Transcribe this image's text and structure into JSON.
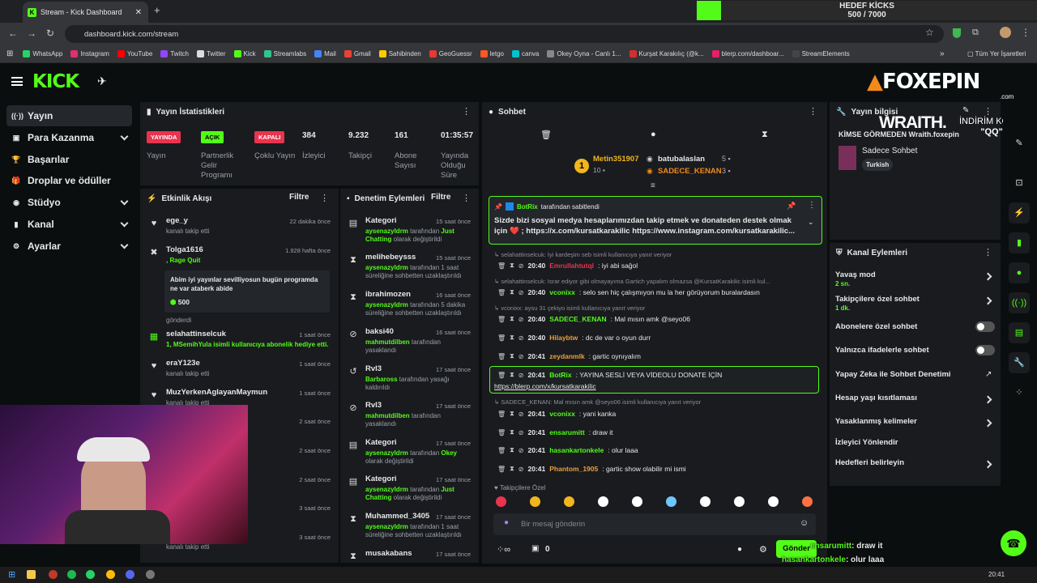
{
  "browser": {
    "tab_title": "Stream - Kick Dashboard",
    "url": "dashboard.kick.com/stream",
    "bookmarks": [
      "WhatsApp",
      "Instagram",
      "YouTube",
      "Twitch",
      "Twitter",
      "Kick",
      "Streamlabs",
      "Mail",
      "Gmail",
      "Sahibinden",
      "GeoGuessr",
      "letgo",
      "canva",
      "Okey Oyna - Canlı 1...",
      "Kurşat Karakılıç (@k...",
      "blerp.com/dashboar...",
      "StreamElements"
    ],
    "other_bookmarks": "Tüm Yer İşaretleri"
  },
  "goal": {
    "title": "HEDEF KİCKS",
    "progress_text": "500 / 7000",
    "progress": 0.0714
  },
  "sidebar": {
    "items": [
      {
        "label": "Yayın",
        "icon": "((·))"
      },
      {
        "label": "Para Kazanma",
        "icon": "▣"
      },
      {
        "label": "Başarılar",
        "icon": "🏆"
      },
      {
        "label": "Droplar ve ödüller",
        "icon": "🎁"
      },
      {
        "label": "Stüdyo",
        "icon": "◉"
      },
      {
        "label": "Kanal",
        "icon": "▮"
      },
      {
        "label": "Ayarlar",
        "icon": "⚙"
      }
    ]
  },
  "stats": {
    "title": "Yayın İstatistikleri",
    "items": [
      {
        "value": "YAYINDA",
        "label": "Yayın"
      },
      {
        "value": "AÇIK",
        "label": "Partnerlik Gelir Programı"
      },
      {
        "value": "KAPALI",
        "label": "Çoklu Yayın"
      },
      {
        "value": "384",
        "label": "İzleyici"
      },
      {
        "value": "9.232",
        "label": "Takipçi"
      },
      {
        "value": "161",
        "label": "Abone Sayısı"
      },
      {
        "value": "01:35:57",
        "label": "Yayında Olduğu Süre"
      }
    ]
  },
  "activity": {
    "title": "Etkinlik Akışı",
    "filter": "Filtre",
    "items": [
      {
        "name": "ege_y",
        "sub": "kanalı takip etti",
        "time": "22 dakika önce"
      },
      {
        "name": "Tolga1616",
        "sub": ", Rage Quit",
        "time": "1.928 hafta önce",
        "msg": "Abim iyi yayınlar sevilliyosun bugün programda ne var ataberk abide",
        "amount": "500",
        "sent": "gönderdi"
      },
      {
        "name": "selahattinselcuk",
        "sub": "1, MSemihYula isimli kullanıcıya abonelik hediye etti.",
        "time": "1 saat önce"
      },
      {
        "name": "eraY123e",
        "sub": "kanalı takip etti",
        "time": "1 saat önce"
      },
      {
        "name": "MuzYerkenAglayanMaymun",
        "sub": "kanalı takip etti",
        "time": "1 saat önce"
      },
      {
        "name": "",
        "sub": "",
        "time": "2 saat önce"
      },
      {
        "name": "",
        "sub": "",
        "time": "2 saat önce"
      },
      {
        "name": "",
        "sub": "",
        "time": "2 saat önce"
      },
      {
        "name": "",
        "sub": "",
        "time": "3 saat önce"
      },
      {
        "name": "",
        "sub": "kanalı takip etti",
        "time": "3 saat önce"
      }
    ]
  },
  "moderation": {
    "title": "Denetim Eylemleri",
    "filter": "Filtre",
    "items": [
      {
        "name": "Kategori",
        "actor": "aysenazyldrm",
        "action": "tarafından",
        "target": "Just Chatting",
        "suffix": "olarak değiştirildi",
        "time": "15 saat önce"
      },
      {
        "name": "melihebeysss",
        "actor": "aysenazyldrm",
        "action": "tarafından 1 saat süreliğine sohbetten uzaklaştırıldı",
        "time": "15 saat önce"
      },
      {
        "name": "ibrahimozen",
        "actor": "aysenazyldrm",
        "action": "tarafından 5 dakika süreliğine sohbetten uzaklaştırıldı",
        "time": "16 saat önce"
      },
      {
        "name": "baksi40",
        "actor": "mahmutdilben",
        "action": "tarafından yasaklandı",
        "time": "16 saat önce"
      },
      {
        "name": "Rvl3",
        "actor": "Barbaross",
        "action": "tarafından yasağı kaldırıldı",
        "time": "17 saat önce"
      },
      {
        "name": "Rvl3",
        "actor": "mahmutdilben",
        "action": "tarafından yasaklandı",
        "time": "17 saat önce"
      },
      {
        "name": "Kategori",
        "actor": "aysenazyldrm",
        "action": "tarafından",
        "target": "Okey",
        "suffix": "olarak değiştirildi",
        "time": "17 saat önce"
      },
      {
        "name": "Kategori",
        "actor": "aysenazyldrm",
        "action": "tarafından",
        "target": "Just Chatting",
        "suffix": "olarak değiştirildi",
        "time": "17 saat önce"
      },
      {
        "name": "Muhammed_3405",
        "actor": "aysenazyldrm",
        "action": "tarafından 1 saat süreliğine sohbetten uzaklaştırıldı",
        "time": "17 saat önce"
      },
      {
        "name": "musakabans",
        "actor": "",
        "action": "",
        "time": "17 saat önce"
      }
    ]
  },
  "chat": {
    "title": "Sohbet",
    "leaders": [
      {
        "name": "Metin351907",
        "count": "10"
      },
      {
        "name": "batubalaslan",
        "count": "5"
      },
      {
        "name": "SADECE_KENAN",
        "count": "3"
      }
    ],
    "pinned": {
      "by": "BotRix",
      "by_suffix": "tarafından sabitlendi",
      "text": "Sizde bizi sosyal medya hesaplarımızdan takip etmek ve donateden destek olmak için ❤️ ; https://x.com/kursatkarakilic https://www.instagram.com/kursatkarakilic..."
    },
    "messages": [
      {
        "reply": "selahattinselcuk: İyi kardeşim seb isimli kullanıcıya yanıt veriyor",
        "time": "20:40",
        "user": "Emrullahtutql",
        "color": "#e8344e",
        "text": "iyi abi sağol"
      },
      {
        "reply": "selahattinselcuk: Israr ediyor gibi olmayayıma Gartich yapalım olmazsa @KursatKarakilic isimli kul...",
        "time": "20:40",
        "user": "vconixx",
        "color": "#53fc18",
        "text": "selo sen hiç çalışmıyon mu la her görüyorum buralardasın"
      },
      {
        "reply": "vconixx: aysu 31 çekiyo isimli kullanıcıya yanıt veriyor",
        "time": "20:40",
        "user": "SADECE_KENAN",
        "color": "#53fc18",
        "text": "Mal mısın amk @seyo06"
      },
      {
        "reply": "",
        "time": "20:40",
        "user": "Hilaybtw",
        "color": "#e8a13a",
        "text": "dc de var o oyun durr"
      },
      {
        "reply": "",
        "time": "20:41",
        "user": "zeydanmlk",
        "color": "#e8a13a",
        "text": "gartic oynıyalım"
      },
      {
        "reply": "",
        "time": "20:41",
        "user": "BotRix",
        "color": "#53fc18",
        "text": "YAYINA SESLİ VEYA VİDEOLU DONATE İÇİN",
        "link": "https://blerp.com/x/kursatkarakilic"
      },
      {
        "reply": "SADECE_KENAN: Mal mısın amk @seyo06 isimli kullanıcıya yanıt veriyor",
        "time": "20:41",
        "user": "vconixx",
        "color": "#53fc18",
        "text": "yani kanka"
      },
      {
        "reply": "",
        "time": "20:41",
        "user": "ensarumitt",
        "color": "#53fc18",
        "text": "draw it"
      },
      {
        "reply": "",
        "time": "20:41",
        "user": "hasankartonkele",
        "color": "#53fc18",
        "text": "olur laaa"
      },
      {
        "reply": "",
        "time": "20:41",
        "user": "Phantom_1905",
        "color": "#e8a13a",
        "text": "gartic show olabilir mi ismi"
      }
    ],
    "followers_only": "Takipçilere Özel",
    "placeholder": "Bir mesaj gönderin",
    "viewers_label": "0",
    "send": "Gönder"
  },
  "stream_info": {
    "title": "Yayın bilgisi",
    "stream_title": "KİMSE GÖRMEDEN Wraith.foxepin",
    "category": "Sadece Sohbet",
    "language": "Turkish"
  },
  "channel_actions": {
    "title": "Kanal Eylemleri",
    "items": [
      {
        "label": "Yavaş mod",
        "sub": "2 sn.",
        "control": "chevron"
      },
      {
        "label": "Takipçilere özel sohbet",
        "sub": "1 dk.",
        "control": "chevron"
      },
      {
        "label": "Abonelere özel sohbet",
        "control": "toggle"
      },
      {
        "label": "Yalnızca ifadelerle sohbet",
        "control": "toggle"
      },
      {
        "label": "Yapay Zeka ile Sohbet Denetimi",
        "control": "external"
      },
      {
        "label": "Hesap yaşı kısıtlaması",
        "control": "chevron"
      },
      {
        "label": "Yasaklanmış kelimeler",
        "control": "chevron"
      },
      {
        "label": "İzleyici Yönlendir",
        "control": "none"
      },
      {
        "label": "Hedefleri belirleyin",
        "control": "chevron"
      }
    ]
  },
  "overlay": {
    "brand": "FOXEPIN",
    "brand_sub": ".com",
    "promo_left": "WRAITH.",
    "promo_right": "İNDİRİM KODU:",
    "promo_code": "\"QQ\"",
    "ticker": [
      {
        "user": "ensarumitt",
        "text": ": draw it"
      },
      {
        "user": "hasankartonkele",
        "text": ": olur laaa"
      },
      {
        "user": "Phantom_1905",
        "text": ": gartic show olabilir mi ismi"
      }
    ]
  },
  "taskbar": {
    "time": "20:41"
  }
}
